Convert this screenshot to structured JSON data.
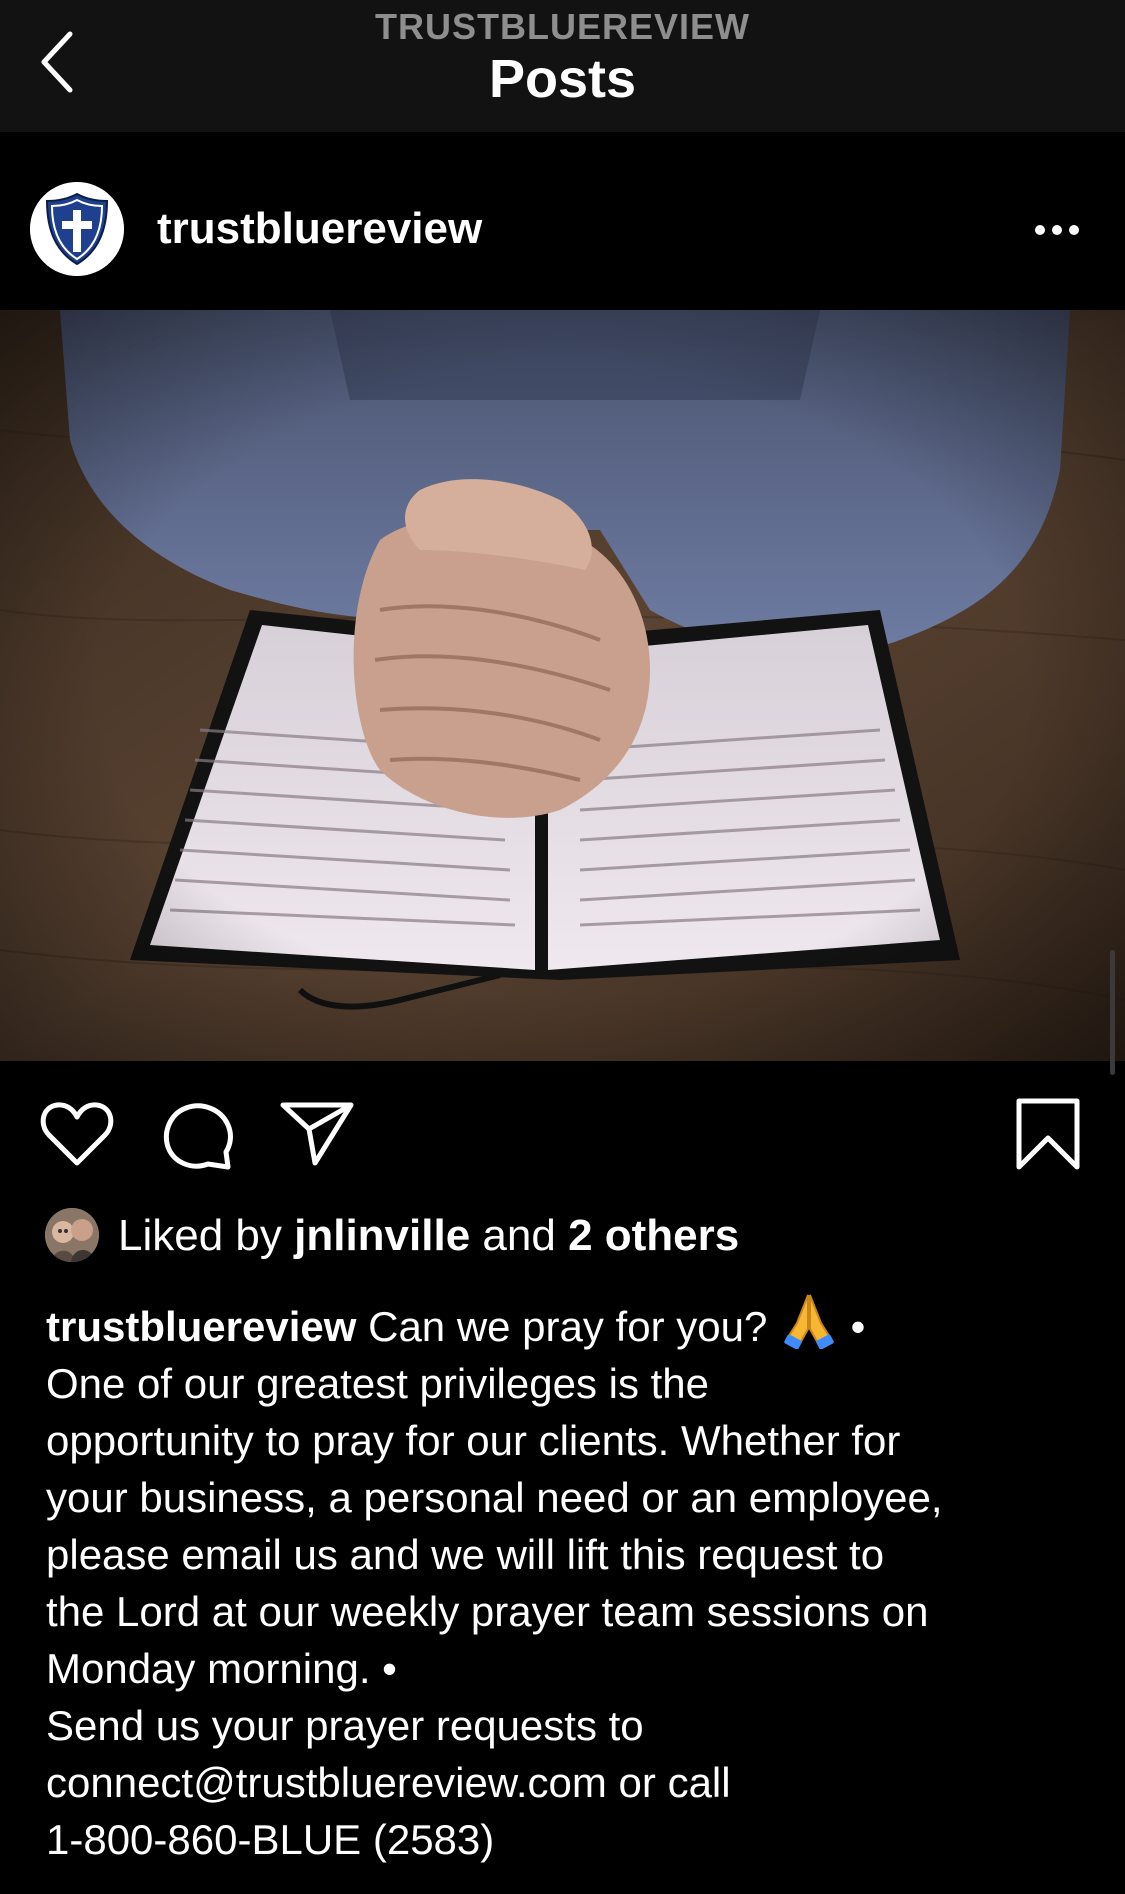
{
  "nav": {
    "subtitle": "TRUSTBLUEREVIEW",
    "title": "Posts",
    "back_icon": "chevron-left-icon"
  },
  "post": {
    "username": "trustbluereview",
    "avatar_icon": "shield-cross-logo",
    "more_icon": "more-horizontal-icon",
    "image_description_icon": "photo",
    "actions": {
      "like_icon": "heart-icon",
      "comment_icon": "comment-icon",
      "share_icon": "send-icon",
      "save_icon": "bookmark-icon"
    },
    "likes": {
      "prefix": "Liked by",
      "user": "jnlinville",
      "middle": "and",
      "others": "2 others"
    },
    "caption": {
      "username": "trustbluereview",
      "lines": [
        "Can we pray for you?",
        "One of our greatest privileges is the",
        "opportunity to pray for our clients. Whether for",
        "your business, a personal need or an employee,",
        "please email us and we will lift this request to",
        "the Lord at our weekly prayer team sessions on",
        "Monday morning. •",
        "Send us your prayer requests to",
        "connect@trustbluereview.com or call",
        "1-800-860-BLUE (2583)"
      ],
      "after_emoji": "•"
    }
  },
  "colors": {
    "background": "#000000",
    "topbar": "#121212",
    "muted": "#8e8e8e",
    "brand_blue": "#1f3f8f"
  }
}
